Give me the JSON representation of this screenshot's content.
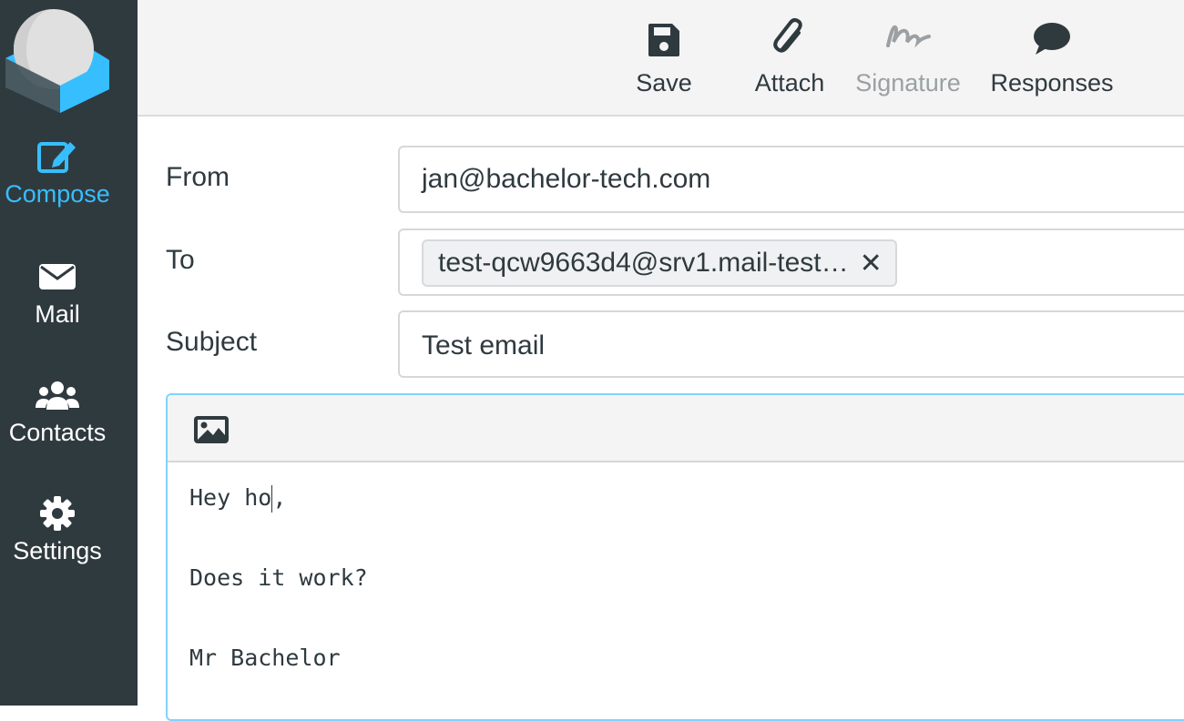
{
  "sidebar": {
    "logo": "roundcube-logo",
    "items": [
      {
        "label": "Compose",
        "icon": "compose-icon",
        "active": true
      },
      {
        "label": "Mail",
        "icon": "envelope-icon",
        "active": false
      },
      {
        "label": "Contacts",
        "icon": "users-icon",
        "active": false
      },
      {
        "label": "Settings",
        "icon": "gear-icon",
        "active": false
      }
    ]
  },
  "toolbar": {
    "save_label": "Save",
    "attach_label": "Attach",
    "signature_label": "Signature",
    "responses_label": "Responses"
  },
  "form": {
    "from_label": "From",
    "from_value": "jan@bachelor-tech.com",
    "to_label": "To",
    "to_recipient": "test-qcw9663d4@srv1.mail-test…",
    "subject_label": "Subject",
    "subject_value": "Test email"
  },
  "editor": {
    "line1_before_caret": "Hey ho",
    "line1_after_caret": ",",
    "line2": "",
    "line3": "Does it work?",
    "line4": "",
    "line5": "Mr Bachelor"
  },
  "colors": {
    "sidebar_bg": "#2f3a3f",
    "accent": "#37beff",
    "toolbar_bg": "#f4f4f4",
    "text": "#2f3a3f",
    "disabled": "#9aa0a3"
  }
}
